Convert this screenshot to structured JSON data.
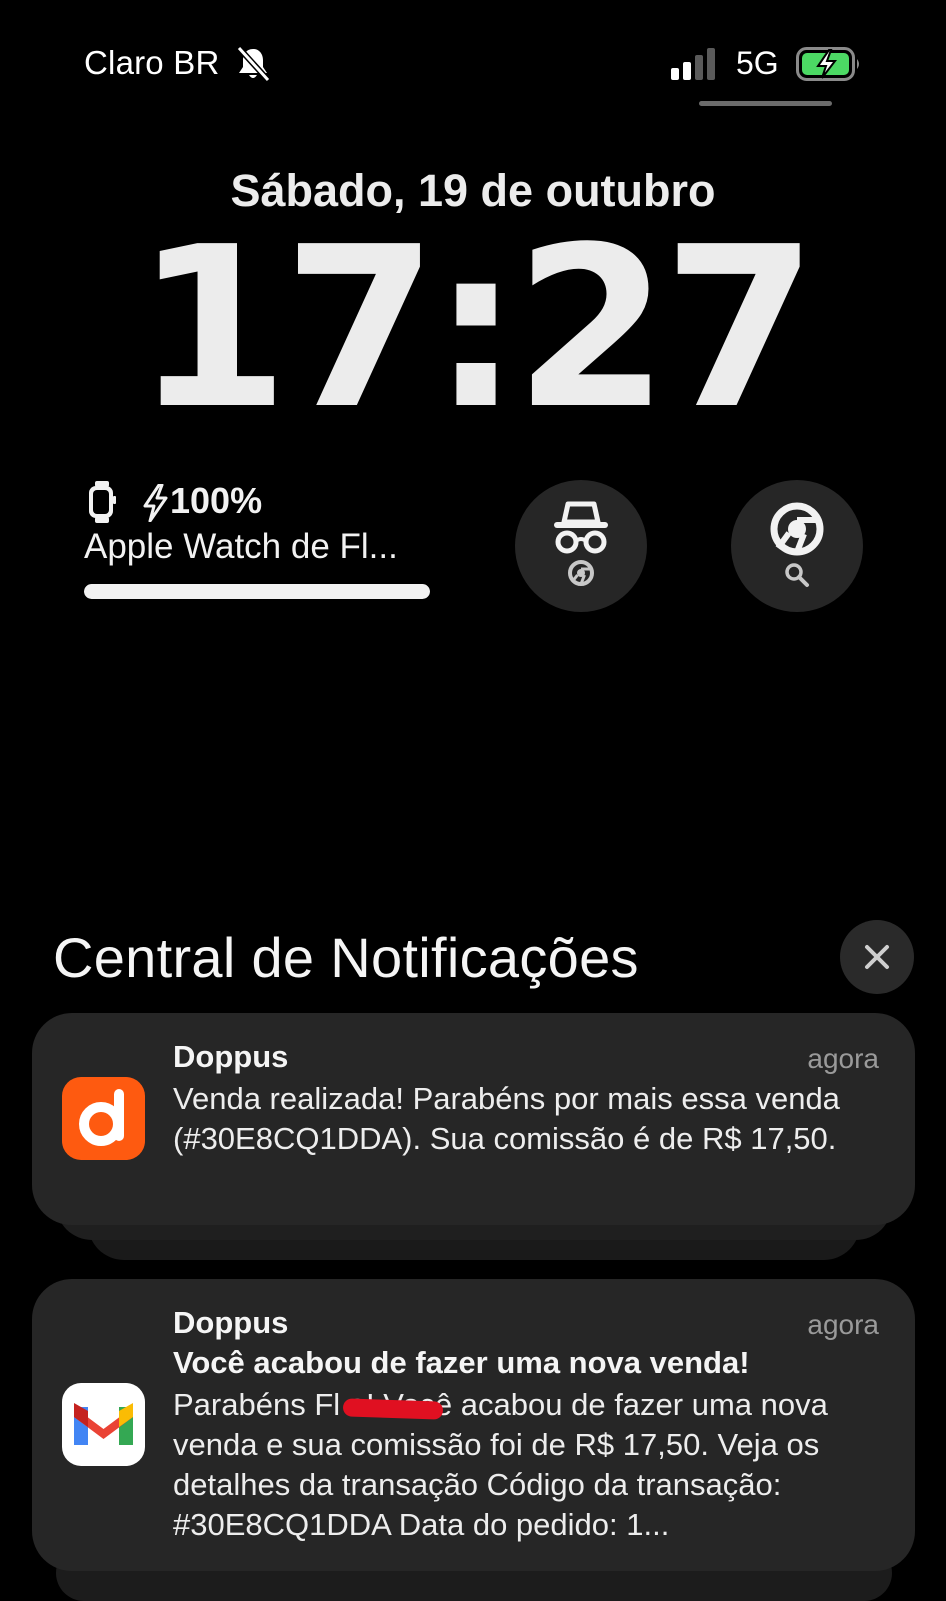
{
  "status_bar": {
    "carrier": "Claro BR",
    "silent_icon": "bell-slash-icon",
    "signal_icon": "cellular-signal-icon",
    "network": "5G",
    "battery_icon": "battery-charging-icon",
    "battery_color": "#4cd964"
  },
  "lock_screen": {
    "date": "Sábado, 19 de outubro",
    "time": "17:27"
  },
  "widgets": {
    "watch": {
      "icon": "apple-watch-icon",
      "charging_icon": "bolt-icon",
      "percent_label": "100%",
      "level": 1.0,
      "name": "Apple Watch de Fl..."
    },
    "incognito": {
      "icon": "incognito-icon",
      "badge_icon": "chrome-icon"
    },
    "chrome_search": {
      "icon": "chrome-icon",
      "badge_icon": "search-icon"
    }
  },
  "notification_center": {
    "title": "Central de Notificações",
    "close_icon": "close-icon",
    "notifications": [
      {
        "app": "Doppus",
        "app_icon": "doppus-icon",
        "icon_color": "#fe5a10",
        "time": "agora",
        "body": "Venda realizada! Parabéns por mais essa venda (#30E8CQ1DDA). Sua comissão é de R$ 17,50."
      },
      {
        "app": "Doppus",
        "app_icon": "gmail-icon",
        "time": "agora",
        "subtitle": "Você acabou de fazer uma nova venda!",
        "body": "Parabéns Fl      o! Você acabou de fazer uma nova venda e sua comissão foi de R$ 17,50. Veja os detalhes da transação Código da transação: #30E8CQ1DDA Data do pedido: 1..."
      }
    ]
  }
}
